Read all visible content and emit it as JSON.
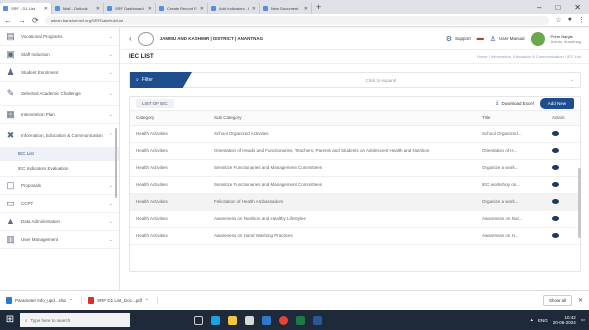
{
  "browser": {
    "tabs": [
      {
        "label": "SRF - D1 List"
      },
      {
        "label": "Mail - Outlook"
      },
      {
        "label": "SRF Dashboard"
      },
      {
        "label": "Create Record Form"
      },
      {
        "label": "Add Indicators - Form"
      },
      {
        "label": "New Document"
      }
    ],
    "url": "admin.transformsrf.org/SRFDataHub/List",
    "new_tab_label": "+",
    "window_controls": [
      "–",
      "□",
      "✕"
    ]
  },
  "sidebar": {
    "items": [
      {
        "label": "Vocational Programs",
        "icon": "book-icon"
      },
      {
        "label": "Staff Induction",
        "icon": "staff-icon"
      },
      {
        "label": "Student Enrolment",
        "icon": "student-icon"
      },
      {
        "label": "Selected Academic Challenge",
        "icon": "challenge-icon"
      },
      {
        "label": "Intervention Plan",
        "icon": "plan-icon"
      },
      {
        "label": "Information, Education & Communication",
        "icon": "iec-icon"
      },
      {
        "label": "IEC List",
        "icon": "list-icon"
      },
      {
        "label": "IEC Indicators Evaluation",
        "icon": "evaluation-icon"
      },
      {
        "label": "Proposals",
        "icon": "proposal-icon"
      },
      {
        "label": "CCPT",
        "icon": "ccpt-icon"
      },
      {
        "label": "Data Administration",
        "icon": "data-icon"
      },
      {
        "label": "User Management",
        "icon": "users-icon"
      }
    ]
  },
  "topbar": {
    "breadcrumb": "JAMMU AND KASHMIR | DISTRICT | ANANTNAG",
    "support_label": "Support",
    "user_manual_label": "User Manual",
    "user_name": "Prem Nargis",
    "user_role": "Admin, Anantnag"
  },
  "page": {
    "title": "IEC LIST",
    "breadcrumb": "Home  /  Information, Education & Communication  /  IEC List"
  },
  "filter": {
    "button_label": "Filter",
    "hint": "Click to expand"
  },
  "list": {
    "title": "LIST OF IEC",
    "download_label": "Download Excel",
    "add_label": "Add New",
    "columns": [
      "Category",
      "Sub Category",
      "Title",
      "Action"
    ],
    "rows": [
      {
        "category": "Health Activities",
        "subcategory": "School Organized Activities",
        "title": "School Organized..."
      },
      {
        "category": "Health Activities",
        "subcategory": "Orientation of Heads and Functionaries, Teachers, Parents and Students on Adolescent Health and Nutrition",
        "title": "Orientation of H..."
      },
      {
        "category": "Health Activities",
        "subcategory": "Sensitize Functionaries and Management Committees",
        "title": "Organize a work..."
      },
      {
        "category": "Health Activities",
        "subcategory": "Sensitize Functionaries and Management Committees",
        "title": "IEC workshop on..."
      },
      {
        "category": "Health Activities",
        "subcategory": "Felicitation of Health Ambassadors",
        "title": "Organize a work..."
      },
      {
        "category": "Health Activities",
        "subcategory": "Awareness on Nutrition and Healthy Lifestyles",
        "title": "Awareness on Nut..."
      },
      {
        "category": "Health Activities",
        "subcategory": "Awareness on Hand Washing Practices",
        "title": "Awareness on H..."
      }
    ]
  },
  "downloads": {
    "items": [
      {
        "label": "Parameter Info_upd...xlsx"
      },
      {
        "label": "SRF D1 List_Doc...pdf"
      }
    ],
    "show_all": "Show all"
  },
  "taskbar": {
    "search_placeholder": "Type here to search",
    "time": "10:42",
    "date": "20-06-2024",
    "lang": "ENG"
  },
  "colors": {
    "primary": "#1f4e8f",
    "taskbar": "#1e2a3a"
  }
}
